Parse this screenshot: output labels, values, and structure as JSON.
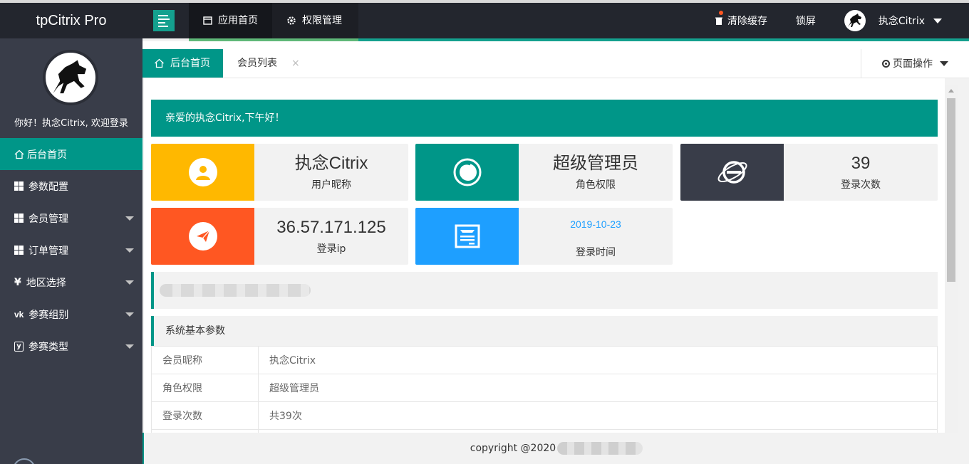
{
  "header": {
    "logo": "tpCitrix Pro",
    "nav": [
      {
        "label": "应用首页",
        "icon": "window-icon"
      },
      {
        "label": "权限管理",
        "icon": "gear-icon"
      }
    ],
    "right": {
      "clear_cache": "清除缓存",
      "lock": "锁屏",
      "user": "执念Citrix"
    }
  },
  "sidebar": {
    "welcome": "你好！执念Citrix, 欢迎登录",
    "items": [
      {
        "label": "后台首页",
        "icon": "home-icon",
        "active": true
      },
      {
        "label": "参数配置",
        "icon": "grid-icon"
      },
      {
        "label": "会员管理",
        "icon": "grid-icon",
        "expandable": true
      },
      {
        "label": "订单管理",
        "icon": "grid-icon",
        "expandable": true
      },
      {
        "label": "地区选择",
        "icon": "yen-icon",
        "expandable": true
      },
      {
        "label": "参赛组别",
        "icon": "vk-icon",
        "expandable": true
      },
      {
        "label": "参赛类型",
        "icon": "y-icon",
        "expandable": true
      }
    ]
  },
  "tabs": {
    "home": "后台首页",
    "members": "会员列表",
    "close": "×",
    "page_ops": "页面操作"
  },
  "banner": "亲爱的执念Citrix,下午好！",
  "cards": [
    {
      "value": "执念Citrix",
      "label": "用户昵称",
      "color": "#ffb800",
      "icon": "user-icon"
    },
    {
      "value": "超级管理员",
      "label": "角色权限",
      "color": "#009688",
      "icon": "role-icon"
    },
    {
      "value": "39",
      "label": "登录次数",
      "color": "#2f4056",
      "icon": "ie-icon"
    },
    {
      "value": "36.57.171.125",
      "label": "登录ip",
      "color": "#ff5722",
      "icon": "paper-plane-icon"
    },
    {
      "value": "2019-10-23",
      "label": "登录时间",
      "color": "#1e9fff",
      "icon": "calendar-icon"
    }
  ],
  "system": {
    "title": "系统基本参数",
    "rows": [
      {
        "key": "会员昵称",
        "value": "执念Citrix"
      },
      {
        "key": "角色权限",
        "value": "超级管理员"
      },
      {
        "key": "登录次数",
        "value": "共39次"
      }
    ]
  },
  "footer": "copyright @2020"
}
